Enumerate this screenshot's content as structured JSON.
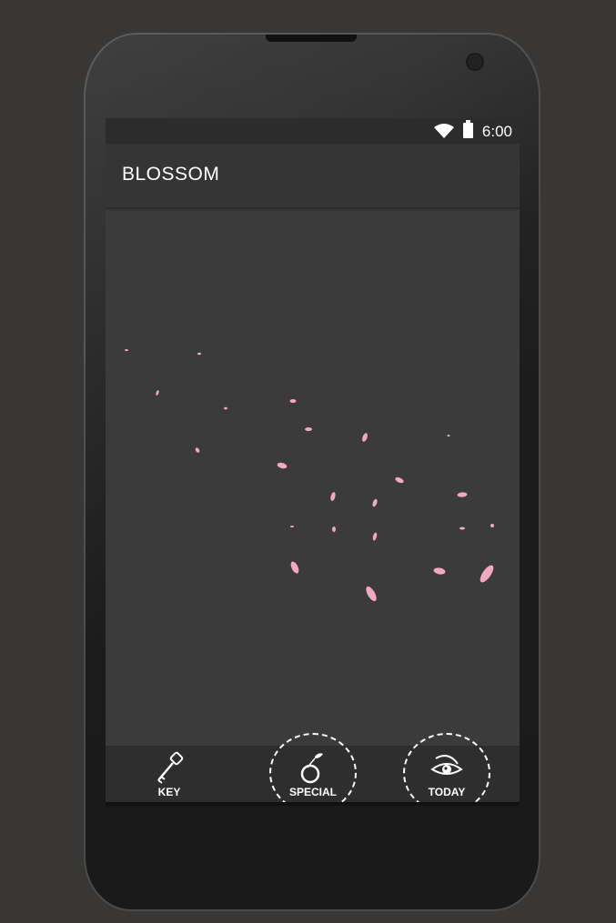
{
  "status_bar": {
    "time": "6:00",
    "icons": [
      "wifi-icon",
      "battery-icon"
    ]
  },
  "app_bar": {
    "title": "BLOSSOM"
  },
  "content": {
    "petal_color": "#f4a7c0",
    "background_color": "#3b3b3b"
  },
  "bottom_nav": {
    "items": [
      {
        "label": "KEY",
        "icon": "key-icon",
        "highlighted": false
      },
      {
        "label": "SPECIAL",
        "icon": "cherry-icon",
        "highlighted": true
      },
      {
        "label": "TODAY",
        "icon": "eye-icon",
        "highlighted": true
      }
    ]
  },
  "colors": {
    "page_bg": "#383735",
    "status_bar": "#2c2c2c",
    "app_bar": "#353535",
    "bottom_bar": "#2e2e2e"
  }
}
